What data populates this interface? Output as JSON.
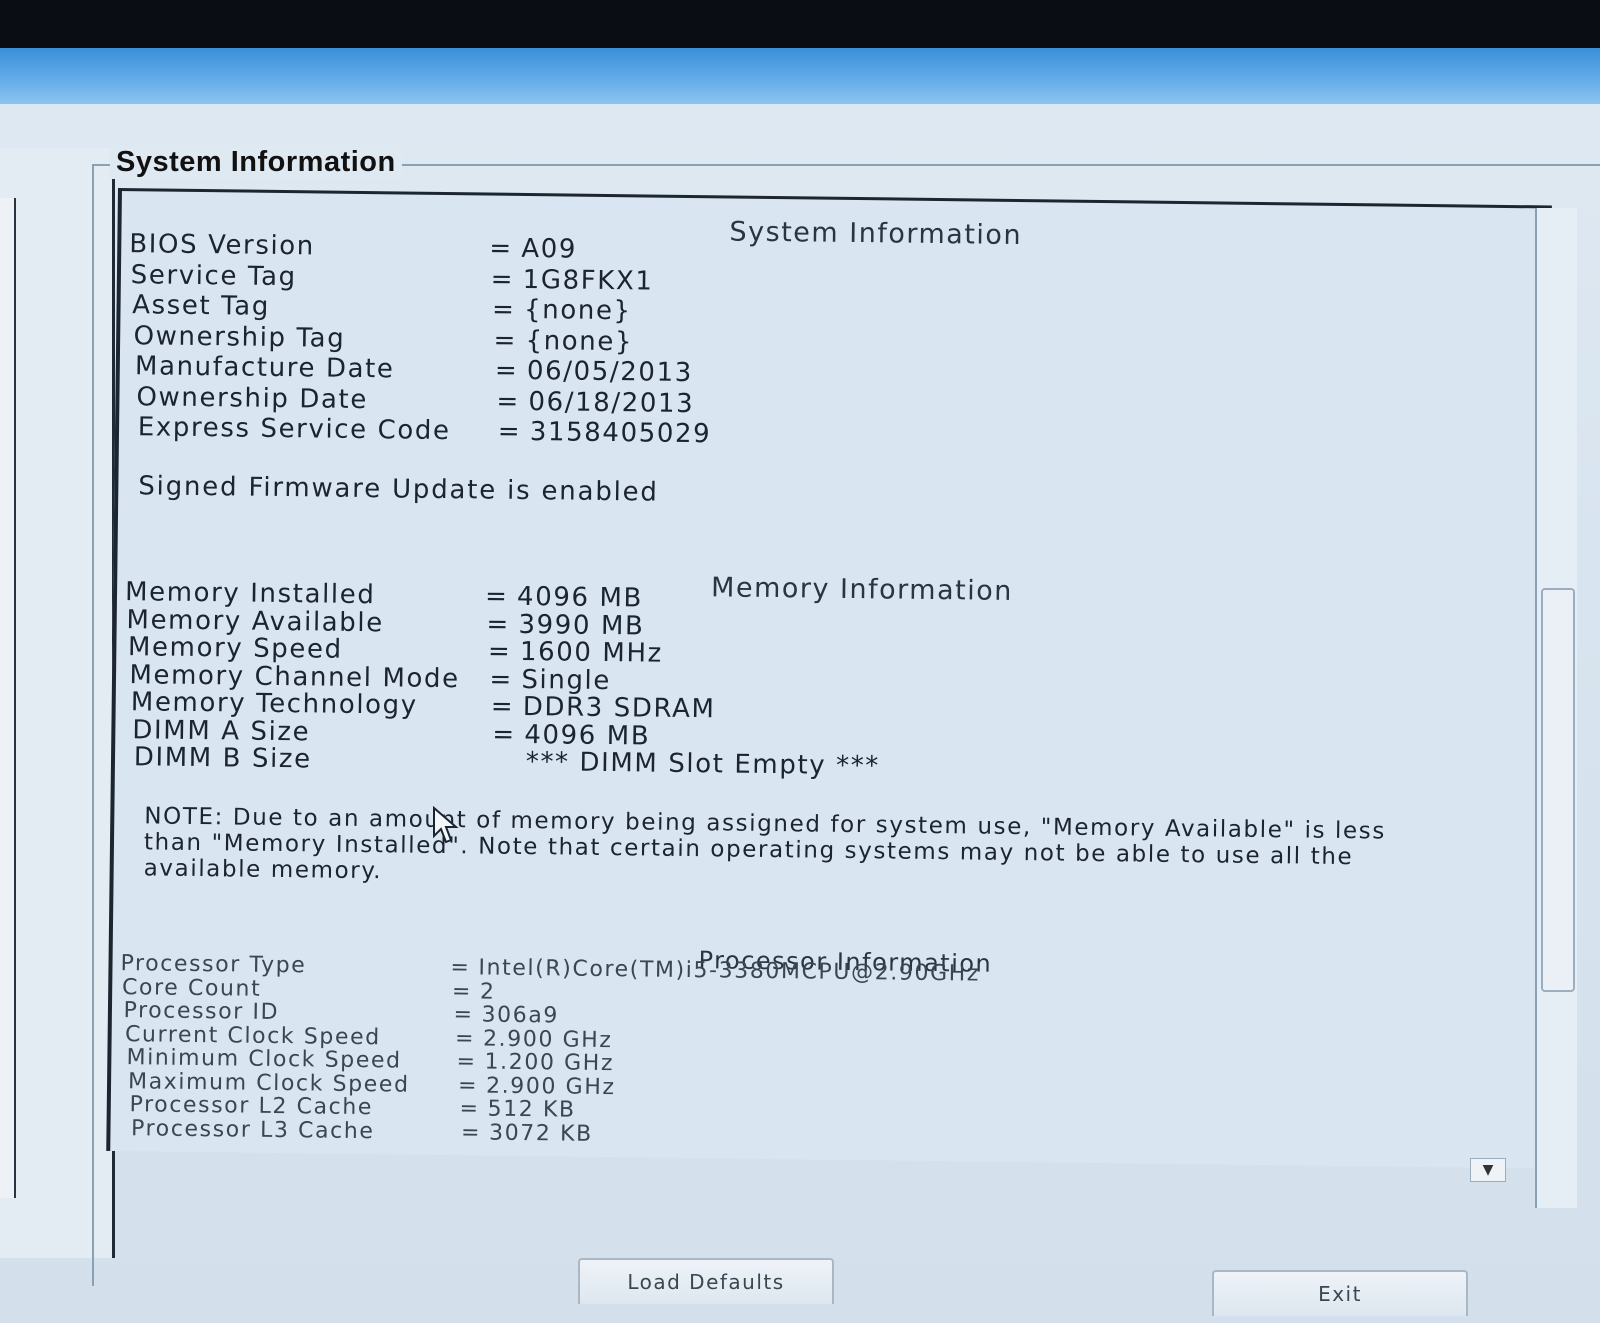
{
  "page": {
    "group_title": "System Information"
  },
  "system": {
    "heading": "System Information",
    "rows": [
      {
        "label": "BIOS Version",
        "value": "A09"
      },
      {
        "label": "Service Tag",
        "value": "1G8FKX1"
      },
      {
        "label": "Asset Tag",
        "value": "{none}"
      },
      {
        "label": "Ownership Tag",
        "value": "{none}"
      },
      {
        "label": "Manufacture Date",
        "value": "06/05/2013"
      },
      {
        "label": "Ownership Date",
        "value": "06/18/2013"
      },
      {
        "label": "Express Service Code",
        "value": "3158405029"
      }
    ],
    "signed_note": "Signed Firmware Update is enabled"
  },
  "memory": {
    "heading": "Memory Information",
    "rows": [
      {
        "label": "Memory Installed",
        "value": "4096 MB"
      },
      {
        "label": "Memory Available",
        "value": "3990 MB"
      },
      {
        "label": "Memory Speed",
        "value": "1600 MHz"
      },
      {
        "label": "Memory Channel Mode",
        "value": "Single"
      },
      {
        "label": "Memory Technology",
        "value": "DDR3 SDRAM"
      },
      {
        "label": "DIMM A Size",
        "value": "4096 MB"
      },
      {
        "label": "DIMM B Size",
        "value": "*** DIMM Slot Empty ***"
      }
    ],
    "note": "NOTE: Due to an amount of memory being assigned for system use, \"Memory Available\" is less than \"Memory Installed\". Note that certain operating systems may not be able to use all the available memory."
  },
  "processor": {
    "heading": "Processor Information",
    "rows": [
      {
        "label": "Processor Type",
        "value": "Intel(R)Core(TM)i5-3380MCPU@2.90GHz"
      },
      {
        "label": "Core Count",
        "value": "2"
      },
      {
        "label": "Processor ID",
        "value": "306a9"
      },
      {
        "label": "Current Clock Speed",
        "value": "2.900 GHz"
      },
      {
        "label": "Minimum Clock Speed",
        "value": "1.200 GHz"
      },
      {
        "label": "Maximum Clock Speed",
        "value": "2.900 GHz"
      },
      {
        "label": "Processor L2 Cache",
        "value": "512 KB"
      },
      {
        "label": "Processor L3 Cache",
        "value": "3072 KB"
      }
    ]
  },
  "buttons": {
    "load_defaults": "Load Defaults",
    "exit": "Exit"
  },
  "icons": {
    "cursor": "mouse-pointer-icon",
    "scroll_down": "chevron-down-icon"
  }
}
